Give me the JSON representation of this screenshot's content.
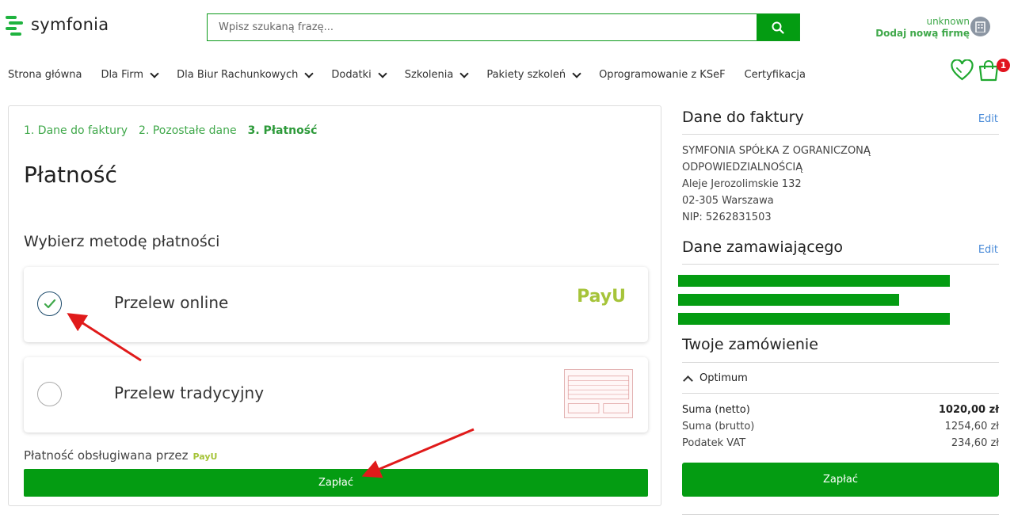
{
  "header": {
    "brand": "symfonia",
    "search_placeholder": "Wpisz szukaną frazę...",
    "account_user": "unknown",
    "account_action": "Dodaj nową firmę",
    "cart_count": "1"
  },
  "nav": [
    {
      "label": "Strona główna",
      "dropdown": false
    },
    {
      "label": "Dla Firm",
      "dropdown": true
    },
    {
      "label": "Dla Biur Rachunkowych",
      "dropdown": true
    },
    {
      "label": "Dodatki",
      "dropdown": true
    },
    {
      "label": "Szkolenia",
      "dropdown": true
    },
    {
      "label": "Pakiety szkoleń",
      "dropdown": true
    },
    {
      "label": "Oprogramowanie z KSeF",
      "dropdown": false
    },
    {
      "label": "Certyfikacja",
      "dropdown": false
    }
  ],
  "checkout": {
    "steps": [
      "1. Dane do faktury",
      "2. Pozostałe dane",
      "3. Płatność"
    ],
    "title": "Płatność",
    "subtitle": "Wybierz metodę płatności",
    "methods": [
      {
        "label": "Przelew online",
        "logo": "PayU",
        "selected": true
      },
      {
        "label": "Przelew tradycyjny",
        "selected": false
      }
    ],
    "handled_by": "Płatność obsługiwana przez",
    "handled_by_logo": "PayU",
    "pay_label": "Zapłać"
  },
  "sidebar": {
    "invoice_title": "Dane do faktury",
    "edit_label": "Edit",
    "invoice_lines": [
      "SYMFONIA SPÓŁKA Z OGRANICZONĄ",
      "ODPOWIEDZIALNOŚCIĄ",
      "Aleje Jerozolimskie 132",
      "02-305 Warszawa",
      "NIP: 5262831503"
    ],
    "orderer_title": "Dane zamawiającego",
    "order_title": "Twoje zamówienie",
    "product": "Optimum",
    "summary": [
      {
        "label": "Suma (netto)",
        "value": "1020,00 zł"
      },
      {
        "label": "Suma (brutto)",
        "value": "1254,60 zł"
      },
      {
        "label": "Podatek VAT",
        "value": "234,60 zł"
      }
    ],
    "pay_label": "Zapłać"
  },
  "colors": {
    "brand_green": "#049c12",
    "link_green": "#3fa84a",
    "edit_blue": "#4a8bd8",
    "badge_red": "#e1141f",
    "payu_green": "#a6c43a"
  }
}
